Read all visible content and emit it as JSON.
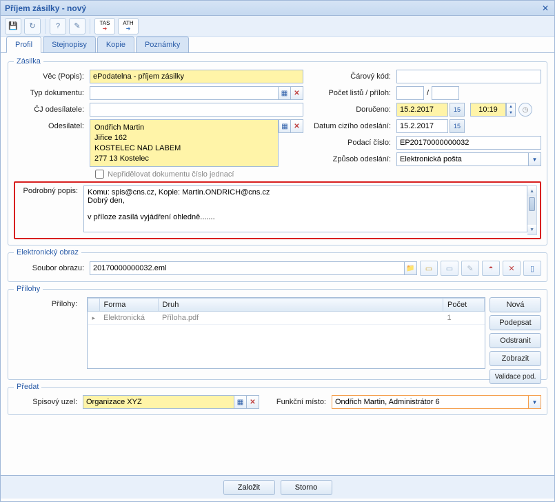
{
  "window": {
    "title": "Příjem zásilky - nový"
  },
  "tabs": [
    "Profil",
    "Stejnopisy",
    "Kopie",
    "Poznámky"
  ],
  "zasilka": {
    "legend": "Zásilka",
    "vec_label": "Věc (Popis):",
    "vec_value": "ePodatelna - příjem zásilky",
    "typ_label": "Typ dokumentu:",
    "typ_value": "",
    "cj_label": "ČJ odesílatele:",
    "cj_value": "",
    "odesilatel_label": "Odesilatel:",
    "odesilatel_lines": [
      "Ondřich Martin",
      "Jiřice 162",
      "KOSTELEC NAD LABEM",
      "277 13 Kostelec"
    ],
    "carovy_label": "Čárový kód:",
    "carovy_value": "",
    "pocet_label": "Počet listů / příloh:",
    "pocet_listu": "",
    "pocet_priloh": "",
    "doruceno_label": "Doručeno:",
    "doruceno_date": "15.2.2017",
    "doruceno_time": "10:19",
    "dco_label": "Datum cizího odeslání:",
    "dco_value": "15.2.2017",
    "podaci_label": "Podací číslo:",
    "podaci_value": "EP20170000000032",
    "zpusob_label": "Způsob odeslání:",
    "zpusob_value": "Elektronická pošta",
    "cal_day": "15",
    "nepridelovat_label": "Nepřidělovat dokumentu číslo jednací",
    "podrobny_label": "Podrobný popis:",
    "podrobny_text": "Komu: spis@cns.cz, Kopie: Martin.ONDRICH@cns.cz\nDobrý den,\n\nv příloze zasílá vyjádření ohledně......."
  },
  "eobraz": {
    "legend": "Elektronický obraz",
    "soubor_label": "Soubor obrazu:",
    "soubor_value": "20170000000032.eml"
  },
  "prilohy": {
    "legend": "Přílohy",
    "label": "Přílohy:",
    "headers": [
      "Forma",
      "Druh",
      "Počet"
    ],
    "rows": [
      {
        "forma": "Elektronická",
        "druh": "Příloha.pdf",
        "pocet": "1"
      }
    ],
    "btn_nova": "Nová",
    "btn_podepsat": "Podepsat",
    "btn_odstranit": "Odstranit",
    "btn_zobrazit": "Zobrazit",
    "btn_validovat": "Validace pod."
  },
  "predat": {
    "legend": "Předat",
    "spisovy_label": "Spisový uzel:",
    "spisovy_value": "Organizace XYZ",
    "fm_label": "Funkční místo:",
    "fm_value": "Ondřich Martin, Administrátor 6"
  },
  "footer": {
    "save": "Založit",
    "cancel": "Storno"
  },
  "tas_btns": [
    "TAS",
    "ATH"
  ]
}
